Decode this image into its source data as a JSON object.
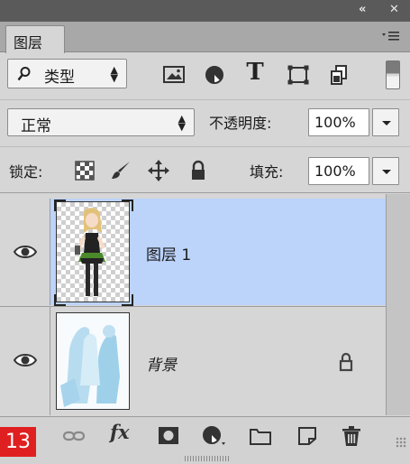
{
  "window": {
    "collapse_glyph": "«",
    "close_glyph": "✕"
  },
  "panel": {
    "tab_label": "图层",
    "menu_icon": "panel-menu-icon"
  },
  "filter": {
    "label": "类型",
    "icons": [
      "image-filter-icon",
      "adjustment-filter-icon",
      "type-filter-icon",
      "shape-filter-icon",
      "smart-object-filter-icon"
    ],
    "type_glyph": "T"
  },
  "blend": {
    "mode": "正常",
    "opacity_label": "不透明度:",
    "opacity_value": "100%"
  },
  "lock": {
    "label": "锁定:",
    "fill_label": "填充:",
    "fill_value": "100%"
  },
  "layers": [
    {
      "name": "图层 1",
      "selected": true,
      "visible": true,
      "locked": false
    },
    {
      "name": "背景",
      "selected": false,
      "visible": true,
      "locked": true
    }
  ],
  "footer": {
    "badge": "13",
    "fx_label": "fx",
    "icons": [
      "link-layers-icon",
      "fx-icon",
      "add-mask-icon",
      "new-adjustment-icon",
      "new-group-icon",
      "new-layer-icon",
      "delete-layer-icon"
    ]
  },
  "colors": {
    "selected_row": "#bcd3fa",
    "panel_bg": "#d6d6d6",
    "badge": "#e02020"
  }
}
